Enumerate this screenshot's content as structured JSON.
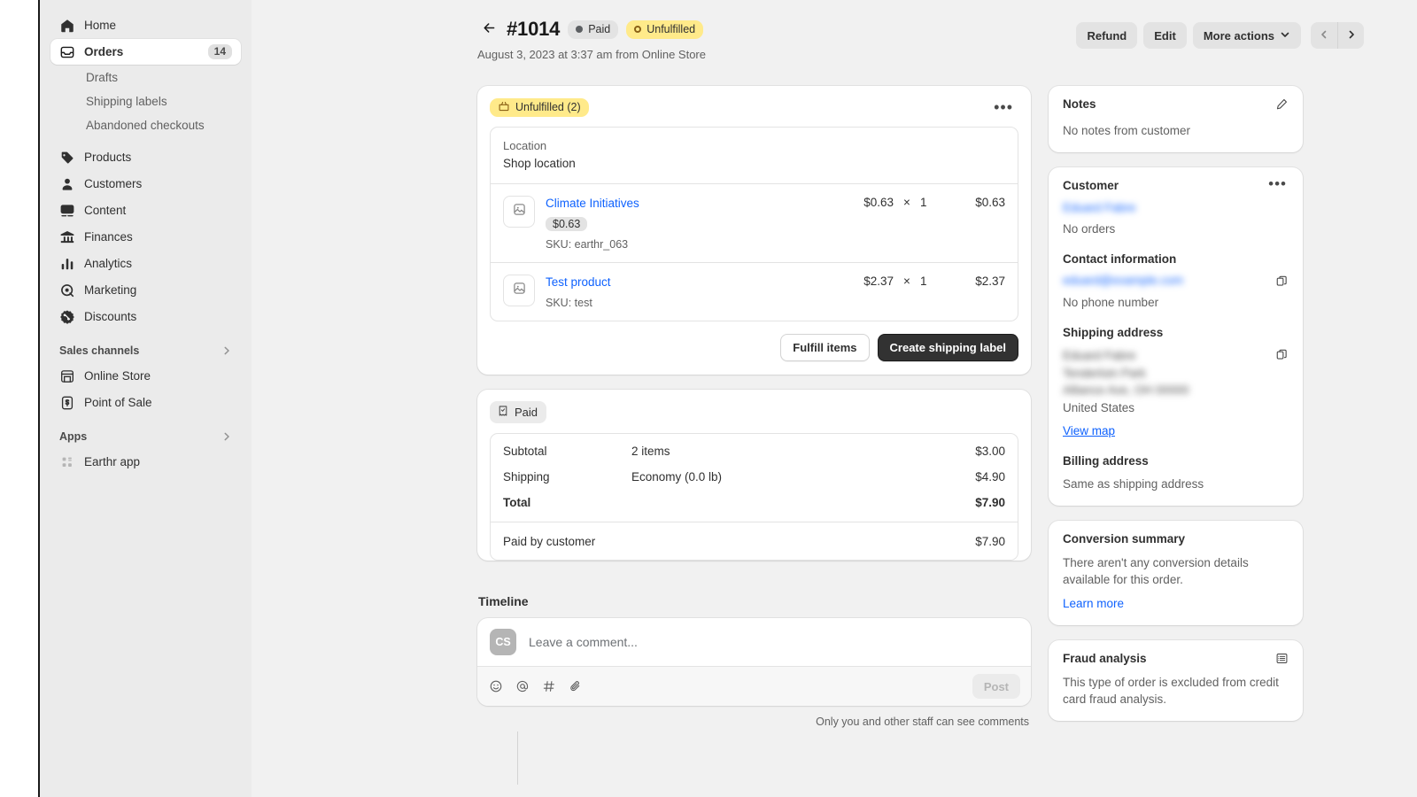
{
  "sidebar": {
    "items": [
      {
        "label": "Home",
        "icon": "home-icon",
        "active": false
      },
      {
        "label": "Orders",
        "icon": "orders-icon",
        "active": true,
        "count": "14"
      },
      {
        "label": "Products",
        "icon": "products-tag-icon",
        "active": false
      },
      {
        "label": "Customers",
        "icon": "customers-person-icon",
        "active": false
      },
      {
        "label": "Content",
        "icon": "content-icon",
        "active": false
      },
      {
        "label": "Finances",
        "icon": "finances-bank-icon",
        "active": false
      },
      {
        "label": "Analytics",
        "icon": "analytics-bars-icon",
        "active": false
      },
      {
        "label": "Marketing",
        "icon": "marketing-target-icon",
        "active": false
      },
      {
        "label": "Discounts",
        "icon": "discounts-percent-icon",
        "active": false
      }
    ],
    "sub_items": [
      "Drafts",
      "Shipping labels",
      "Abandoned checkouts"
    ],
    "sections": [
      {
        "label": "Sales channels",
        "items": [
          {
            "label": "Online Store",
            "icon": "store-icon"
          },
          {
            "label": "Point of Sale",
            "icon": "pos-icon"
          }
        ]
      },
      {
        "label": "Apps",
        "items": [
          {
            "label": "Earthr app",
            "icon": "app-grid-icon"
          }
        ]
      }
    ]
  },
  "header": {
    "back": "←",
    "order_number": "#1014",
    "status_paid": "Paid",
    "status_fulfillment": "Unfulfilled",
    "subtitle": "August 3, 2023 at 3:37 am from Online Store",
    "actions": {
      "refund": "Refund",
      "edit": "Edit",
      "more": "More actions",
      "prev": "‹",
      "next": "›"
    }
  },
  "fulfillment_card": {
    "badge": "Unfulfilled (2)",
    "kebab": "•••",
    "location_label": "Location",
    "location_value": "Shop location",
    "items": [
      {
        "title": "Climate Initiatives",
        "variant": "$0.63",
        "sku": "SKU: earthr_063",
        "unit_price": "$0.63",
        "times": "×",
        "qty": "1",
        "total": "$0.63"
      },
      {
        "title": "Test product",
        "variant": "",
        "sku": "SKU: test",
        "unit_price": "$2.37",
        "times": "×",
        "qty": "1",
        "total": "$2.37"
      }
    ],
    "fulfill_button": "Fulfill items",
    "shipping_label_button": "Create shipping label"
  },
  "payment_card": {
    "badge": "Paid",
    "rows": [
      {
        "label": "Subtotal",
        "detail": "2 items",
        "value": "$3.00",
        "strong": false
      },
      {
        "label": "Shipping",
        "detail": "Economy (0.0 lb)",
        "value": "$4.90",
        "strong": false
      },
      {
        "label": "Total",
        "detail": "",
        "value": "$7.90",
        "strong": true
      }
    ],
    "paid_row": {
      "label": "Paid by customer",
      "detail": "",
      "value": "$7.90"
    }
  },
  "timeline": {
    "title": "Timeline",
    "avatar_initials": "CS",
    "placeholder": "Leave a comment...",
    "tools": [
      "emoji-icon",
      "mention-icon",
      "hashtag-icon",
      "attachment-icon"
    ],
    "post_button": "Post",
    "note": "Only you and other staff can see comments"
  },
  "notes_card": {
    "title": "Notes",
    "edit_icon": "pencil-icon",
    "text": "No notes from customer"
  },
  "customer_card": {
    "title": "Customer",
    "kebab": "•••",
    "name_redacted": "Eduard Fabre",
    "orders_text": "No orders",
    "contact_title": "Contact information",
    "email_redacted": "eduard@example.com",
    "phone_text": "No phone number",
    "shipping_title": "Shipping address",
    "shipping_lines": [
      "Eduard Fabre",
      "Tenderloin Park",
      "Alliance Ave, OH 00000"
    ],
    "shipping_country": "United States",
    "view_map": "View map",
    "billing_title": "Billing address",
    "billing_text": "Same as shipping address",
    "copy_icon": "copy-icon"
  },
  "conversion_card": {
    "title": "Conversion summary",
    "text": "There aren't any conversion details available for this order.",
    "link": "Learn more"
  },
  "fraud_card": {
    "title": "Fraud analysis",
    "icon": "list-icon",
    "text": "This type of order is excluded from credit card fraud analysis."
  },
  "colors": {
    "accent_link": "#0f62fe",
    "badge_yellow": "#ffea8a",
    "badge_gray": "#e3e3e3",
    "dark_button": "#323232",
    "sidebar_bg": "#ebebeb",
    "page_bg": "#f1f1f1"
  }
}
